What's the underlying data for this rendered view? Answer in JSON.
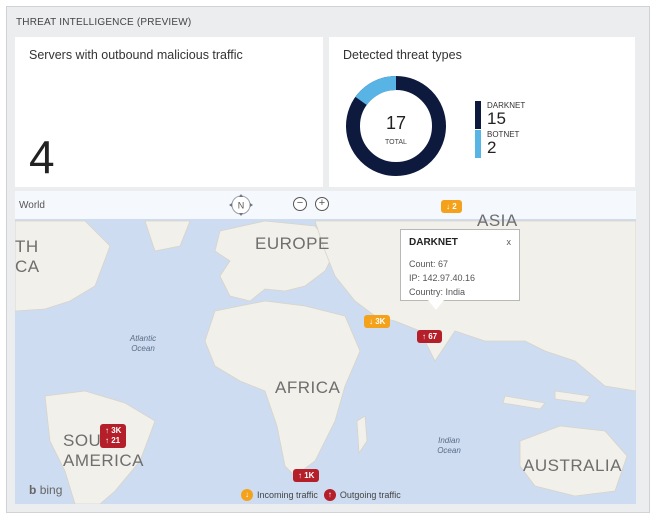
{
  "panel": {
    "title": "THREAT INTELLIGENCE (PREVIEW)"
  },
  "servers_tile": {
    "title": "Servers with outbound malicious traffic",
    "value": "4"
  },
  "threats_tile": {
    "title": "Detected threat types",
    "total": "17",
    "total_label": "TOTAL",
    "items": [
      {
        "name": "DARKNET",
        "count": "15",
        "color": "#0e1a3d"
      },
      {
        "name": "BOTNET",
        "count": "2",
        "color": "#59b4e6"
      }
    ]
  },
  "map": {
    "scope_label": "World",
    "compass_label": "N",
    "zoom_out": "−",
    "zoom_in": "+",
    "regions": {
      "europe": "EUROPE",
      "asia": "ASIA",
      "africa": "AFRICA",
      "south_america": "SOUTH AMERICA",
      "australia": "AUSTRALIA",
      "north_america_partial": "TH CA"
    },
    "oceans": {
      "atlantic": "Atlantic Ocean",
      "indian": "Indian Ocean"
    },
    "pins": [
      {
        "label": "2",
        "direction": "incoming"
      },
      {
        "label": "3K",
        "direction": "incoming"
      },
      {
        "label": "67",
        "direction": "outgoing"
      },
      {
        "label": "3K",
        "direction": "outgoing"
      },
      {
        "label": "21",
        "direction": "outgoing"
      },
      {
        "label": "1K",
        "direction": "outgoing"
      }
    ],
    "tooltip": {
      "title": "DARKNET",
      "close": "x",
      "count": "Count: 67",
      "ip": "IP: 142.97.40.16",
      "country": "Country: India"
    },
    "brand": "bing",
    "legend": {
      "incoming": "Incoming traffic",
      "outgoing": "Outgoing traffic"
    },
    "colors": {
      "incoming": "#f4a21b",
      "outgoing": "#b41f29",
      "water": "#cddcf0",
      "land": "#f2f0ea"
    }
  }
}
